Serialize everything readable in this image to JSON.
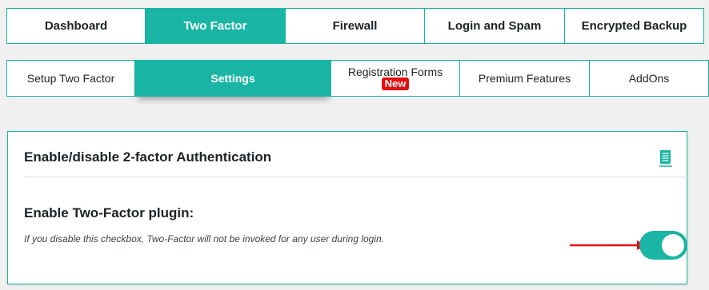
{
  "top_tabs": [
    {
      "label": "Dashboard",
      "active": false
    },
    {
      "label": "Two Factor",
      "active": true
    },
    {
      "label": "Firewall",
      "active": false
    },
    {
      "label": "Login and Spam",
      "active": false
    },
    {
      "label": "Encrypted Backup",
      "active": false
    }
  ],
  "sub_tabs": [
    {
      "label": "Setup Two Factor",
      "active": false
    },
    {
      "label": "Settings",
      "active": true
    },
    {
      "label": "Registration Forms",
      "badge": "New",
      "active": false
    },
    {
      "label": "Premium Features",
      "active": false
    },
    {
      "label": "AddOns",
      "active": false
    }
  ],
  "panel": {
    "title": "Enable/disable 2-factor Authentication",
    "doc_icon": "document-icon",
    "section_title": "Enable Two-Factor plugin:",
    "description": "If you disable this checkbox, Two-Factor will not be invoked for any user during login.",
    "toggle_on": true
  },
  "colors": {
    "accent": "#1ab5a4",
    "badge": "#e50c0c",
    "arrow": "#e50c0c"
  }
}
